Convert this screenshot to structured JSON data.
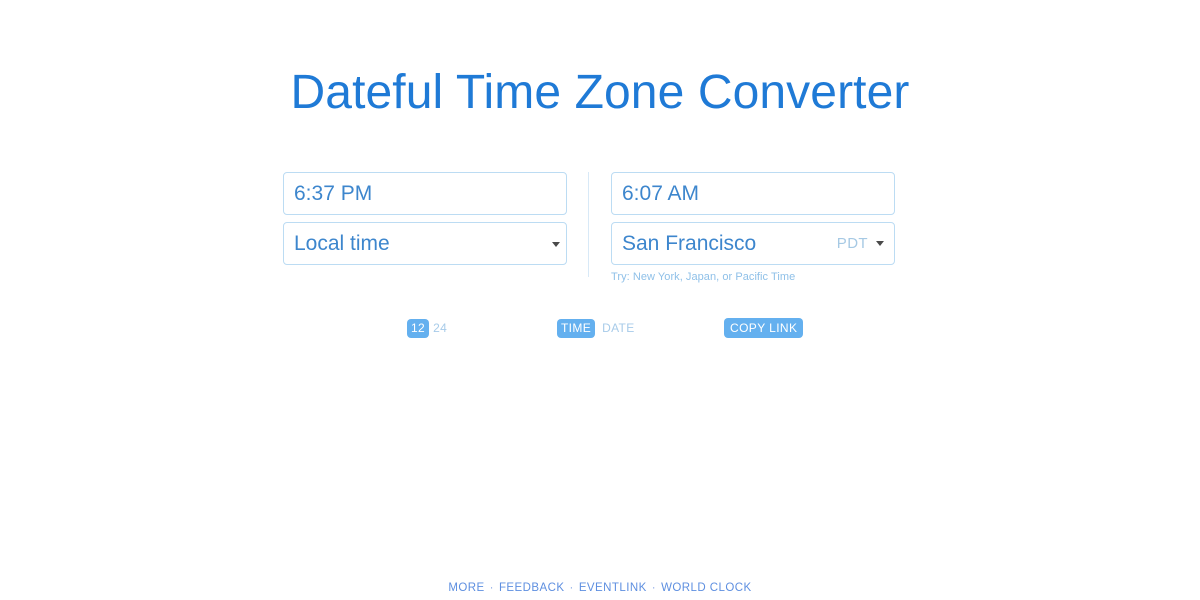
{
  "page": {
    "title": "Dateful Time Zone Converter",
    "background_color": "#ffffff",
    "accent_color": "#1f7ad6",
    "toggle_active_color": "#64b0ef"
  },
  "converter": {
    "source": {
      "time_value": "6:37 PM",
      "zone_value": "Local time",
      "zone_abbr": "",
      "caret_icon": "chevron-down-icon"
    },
    "target": {
      "time_value": "6:07 AM",
      "zone_value": "San Francisco",
      "zone_abbr": "PDT",
      "caret_icon": "chevron-down-icon",
      "hint": "Try: New York, Japan, or Pacific Time"
    }
  },
  "controls": {
    "hour_format": {
      "options": [
        "12",
        "24"
      ],
      "selected": "12",
      "option_12": "12",
      "option_24": "24"
    },
    "mode": {
      "options": [
        "TIME",
        "DATE"
      ],
      "selected": "TIME",
      "option_time": "TIME",
      "option_date": "DATE"
    },
    "copy_link_label": "COPY LINK"
  },
  "footer": {
    "separator": "·",
    "links": [
      {
        "label": "MORE"
      },
      {
        "label": "FEEDBACK"
      },
      {
        "label": "EVENTLINK"
      },
      {
        "label": "WORLD CLOCK"
      }
    ]
  }
}
